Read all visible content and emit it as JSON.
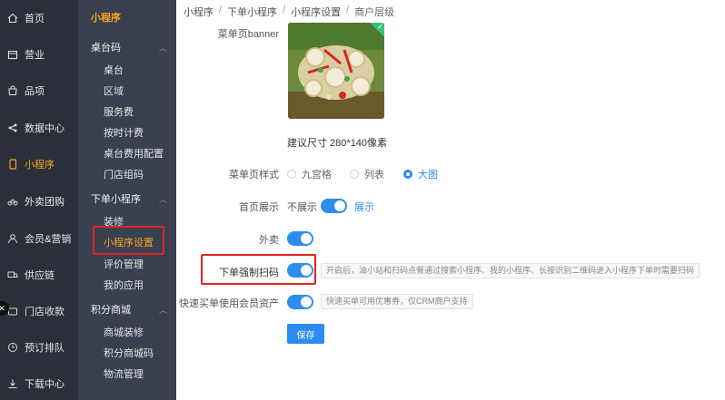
{
  "nav": {
    "items": [
      {
        "label": "首页",
        "icon": "home-icon"
      },
      {
        "label": "营业",
        "icon": "calendar-icon"
      },
      {
        "label": "品项",
        "icon": "bag-icon"
      },
      {
        "label": "数据中心",
        "icon": "share-icon"
      },
      {
        "label": "小程序",
        "icon": "phone-icon"
      },
      {
        "label": "外卖团购",
        "icon": "bike-icon"
      },
      {
        "label": "会员&营销",
        "icon": "user-icon"
      },
      {
        "label": "供应链",
        "icon": "truck-icon"
      },
      {
        "label": "门店收款",
        "icon": "wallet-icon"
      },
      {
        "label": "预订排队",
        "icon": "clock-icon"
      },
      {
        "label": "下载中心",
        "icon": "download-icon"
      }
    ],
    "active": "小程序"
  },
  "subnav": {
    "title": "小程序",
    "groups": [
      {
        "label": "桌台码",
        "items": [
          "桌台",
          "区域",
          "服务费",
          "按时计费",
          "桌台费用配置",
          "门店组码"
        ]
      },
      {
        "label": "下单小程序",
        "items": [
          "装修",
          "小程序设置",
          "评价管理",
          "我的应用"
        ]
      },
      {
        "label": "积分商城",
        "items": [
          "商城装修",
          "积分商城码",
          "物流管理"
        ]
      }
    ],
    "active": "小程序设置"
  },
  "breadcrumb": [
    "小程序",
    "下单小程序",
    "小程序设置",
    "商户层级"
  ],
  "form": {
    "banner_label": "菜单页banner",
    "banner_hint": "建议尺寸 280*140像素",
    "style_label": "菜单页样式",
    "style_options": [
      "九宫格",
      "列表",
      "大图"
    ],
    "style_selected": "大图",
    "home_label": "首页展示",
    "home_off": "不展示",
    "home_on": "展示",
    "takeout_label": "外卖",
    "force_scan_label": "下单强制扫码",
    "force_scan_tip": "开启后，油小站和扫码点餐通过搜索小程序、我的小程序、长按识别二维码进入小程序下单时需要扫码",
    "member_label": "快速买单使用会员资产",
    "member_tip": "快速买单可用优惠券，仅CRM商户支持",
    "save_label": "保存"
  },
  "colors": {
    "accent": "#2d8cf0",
    "active_nav": "#f5a623",
    "highlight": "#e02424"
  }
}
